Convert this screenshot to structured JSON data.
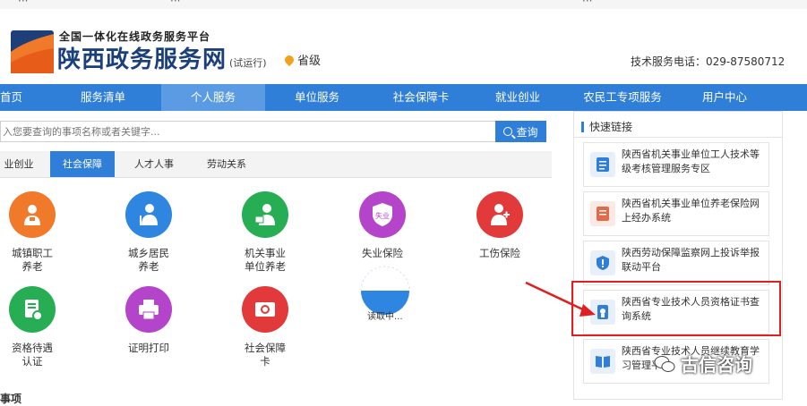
{
  "top_strip": {
    "left1": "···",
    "left2": "···",
    "right": "···"
  },
  "header": {
    "subtitle": "全国一体化在线政务服务平台",
    "title": "陕西政务服务网",
    "trial": "(试运行)",
    "location": "省级",
    "phone": "技术服务电话：029-87580712"
  },
  "nav": [
    {
      "label": "首页"
    },
    {
      "label": "服务清单"
    },
    {
      "label": "个人服务",
      "active": true
    },
    {
      "label": "单位服务"
    },
    {
      "label": "社会保障卡"
    },
    {
      "label": "就业创业"
    },
    {
      "label": "农民工专项服务"
    },
    {
      "label": "用户中心"
    }
  ],
  "search": {
    "placeholder": "入您要查询的事项名称或者关键字...",
    "button": "查询"
  },
  "tabs": [
    "业创业",
    "社会保障",
    "人才人事",
    "劳动关系"
  ],
  "services": [
    {
      "line1": "城镇职工",
      "line2": "养老",
      "color": "#f07a2a",
      "icon": "elderly-worker-icon"
    },
    {
      "line1": "城乡居民",
      "line2": "养老",
      "color": "#2f86e0",
      "icon": "elderly-resident-icon"
    },
    {
      "line1": "机关事业",
      "line2": "单位养老",
      "color": "#27ad54",
      "icon": "institution-pension-icon"
    },
    {
      "line1": "失业保险",
      "line2": "",
      "color": "#b444c9",
      "icon": "unemployment-shield-icon",
      "badge": "失业"
    },
    {
      "line1": "工伤保险",
      "line2": "",
      "color": "#e23a3a",
      "icon": "injury-insurance-icon"
    },
    {
      "line1": "资格待遇",
      "line2": "认证",
      "color": "#27ad54",
      "icon": "qualification-doc-icon"
    },
    {
      "line1": "证明打印",
      "line2": "",
      "color": "#b444c9",
      "icon": "printer-icon"
    },
    {
      "line1": "社会保障",
      "line2": "卡",
      "color": "#e23a3a",
      "icon": "social-card-icon"
    }
  ],
  "loading": "读取中...",
  "quick_links": {
    "title": "快速链接",
    "items": [
      {
        "text": "陕西省机关事业单位工人技术等级考核管理服务专区",
        "icon": "document-list-icon",
        "color": "#2f7ed8"
      },
      {
        "text": "陕西省机关事业单位养老保险网上经办系统",
        "icon": "document-red-icon",
        "color": "#e06a4a"
      },
      {
        "text": "陕西劳动保障监察网上投诉举报联动平台",
        "icon": "shield-alert-icon",
        "color": "#2f7ed8"
      },
      {
        "text": "陕西省专业技术人员资格证书查询系统",
        "icon": "certificate-icon",
        "color": "#2f7ed8"
      },
      {
        "text": "陕西省专业技术人员继续教育学习管理平台",
        "icon": "book-icon",
        "color": "#2f7ed8"
      }
    ]
  },
  "bottom_heading": "事项",
  "watermark": "古信咨询",
  "colors": {
    "primary": "#2f7ed8",
    "nav_active": "#5a9be3",
    "highlight": "#e02020",
    "title": "#1a3f7a"
  }
}
